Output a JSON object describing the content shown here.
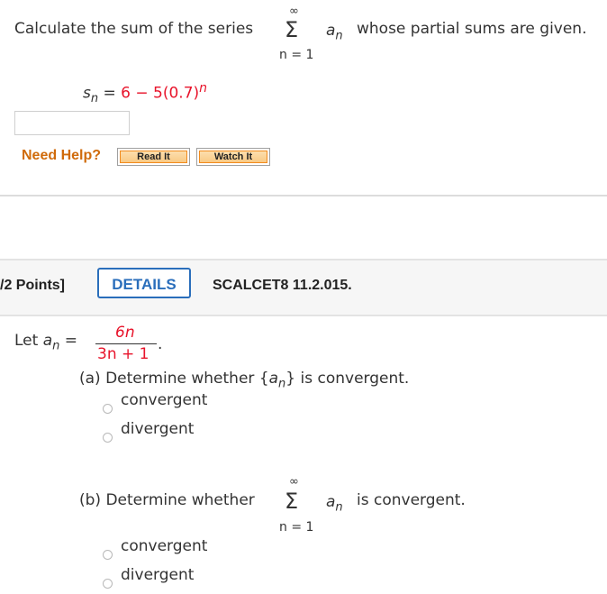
{
  "prev_question": {
    "prompt_before": "Calculate the sum of the series",
    "sigma": "Σ",
    "sigma_upper": "∞",
    "sigma_lower": "n = 1",
    "term": "a",
    "term_sub": "n",
    "prompt_after": "whose partial sums are given.",
    "formula_lhs_s": "s",
    "formula_lhs_sub": "n",
    "formula_eq": "=",
    "formula_rhs": "6 − 5(0.7)",
    "formula_exp": "n",
    "answer_value": ""
  },
  "help": {
    "label": "Need Help?",
    "read_it": "Read It",
    "watch_it": "Watch It"
  },
  "question_header": {
    "points": "/2 Points]",
    "details_button": "DETAILS",
    "code": "SCALCET8 11.2.015."
  },
  "question": {
    "let": "Let",
    "a": "a",
    "a_sub": "n",
    "eq": "=",
    "numerator": "6n",
    "denominator": "3n + 1",
    "period": ".",
    "part_a": {
      "prefix": "(a) Determine whether {",
      "a": "a",
      "sub": "n",
      "suffix": "} is convergent.",
      "options": [
        "convergent",
        "divergent"
      ]
    },
    "part_b": {
      "prefix": "(b) Determine whether",
      "sigma": "Σ",
      "sigma_upper": "∞",
      "sigma_lower": "n = 1",
      "a": "a",
      "sub": "n",
      "suffix": "is convergent.",
      "options": [
        "convergent",
        "divergent"
      ]
    }
  }
}
